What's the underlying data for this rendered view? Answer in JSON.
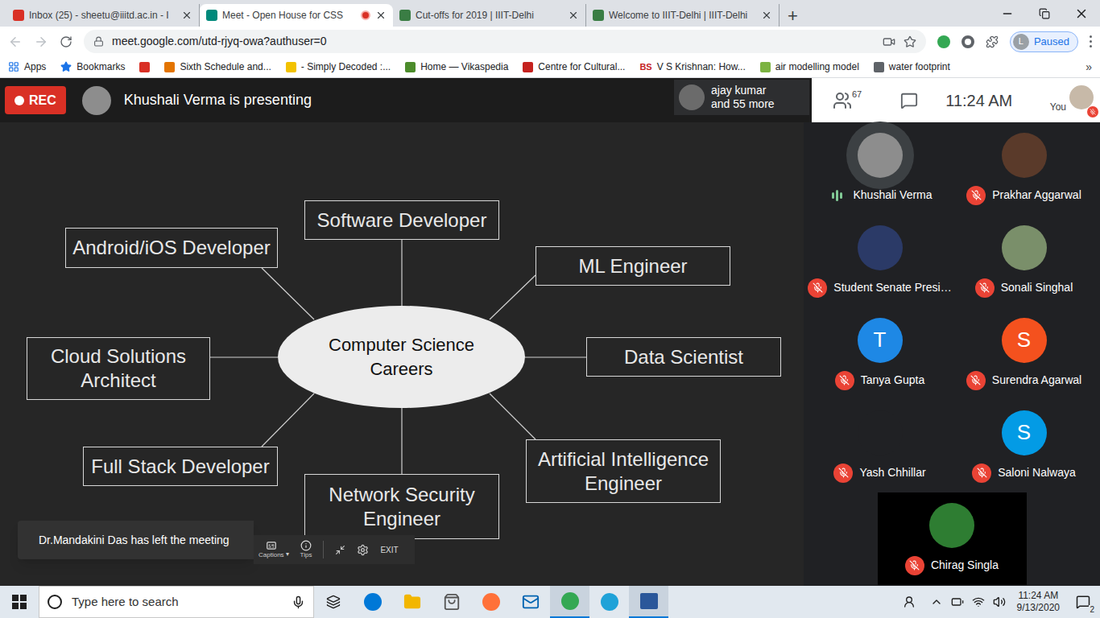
{
  "browser": {
    "tabs": [
      {
        "title": "Inbox (25) - sheetu@iiitd.ac.in - I",
        "selected": false,
        "recording": false,
        "color": "#d93025"
      },
      {
        "title": "Meet - Open House for CSS",
        "selected": true,
        "recording": true,
        "color": "#00897b"
      },
      {
        "title": "Cut-offs for 2019 | IIIT-Delhi",
        "selected": false,
        "recording": false,
        "color": "#3a7d44"
      },
      {
        "title": "Welcome to IIIT-Delhi | IIIT-Delhi",
        "selected": false,
        "recording": false,
        "color": "#3a7d44"
      }
    ],
    "new_tab": "+",
    "url": "meet.google.com/utd-rjyq-owa?authuser=0",
    "profile": {
      "initial": "L",
      "status": "Paused"
    },
    "bookmarks": [
      {
        "label": "Apps",
        "color": "#1a73e8",
        "icon_text": ""
      },
      {
        "label": "Bookmarks",
        "color": "#1a73e8",
        "icon_text": ""
      },
      {
        "label": "",
        "color": "#d93025",
        "icon_text": ""
      },
      {
        "label": "Sixth Schedule and...",
        "color": "#e37400",
        "icon_text": ""
      },
      {
        "label": "- Simply Decoded :...",
        "color": "#f2c200",
        "icon_text": ""
      },
      {
        "label": "Home — Vikaspedia",
        "color": "#4c8c2b",
        "icon_text": ""
      },
      {
        "label": "Centre for Cultural...",
        "color": "#c5221f",
        "icon_text": ""
      },
      {
        "label": "V S Krishnan: How...",
        "color": "#c5221f",
        "icon_text": "BS"
      },
      {
        "label": "air modelling model",
        "color": "#7cb342",
        "icon_text": ""
      },
      {
        "label": "water footprint",
        "color": "#5f6368",
        "icon_text": ""
      }
    ],
    "more_bookmarks": "»"
  },
  "meeting": {
    "rec": "REC",
    "presenter": "Khushali Verma is presenting",
    "others": {
      "name": "ajay kumar",
      "more": "and 55 more"
    },
    "people_count": "67",
    "time": "11:24 AM",
    "self_label": "You",
    "self_muted": true
  },
  "slide": {
    "center": "Computer Science Careers",
    "careers": [
      "Software Developer",
      "ML Engineer",
      "Data Scientist",
      "Artificial Intelligence Engineer",
      "Network Security Engineer",
      "Full Stack Developer",
      "Cloud Solutions Architect",
      "Android/iOS Developer"
    ]
  },
  "participants": [
    {
      "name": "Khushali Verma",
      "muted": false,
      "speaking": true,
      "kind": "photo",
      "letter": "",
      "color": "#8d8d8d"
    },
    {
      "name": "Prakhar Aggarwal",
      "muted": true,
      "speaking": false,
      "kind": "photo",
      "letter": "",
      "color": "#5a3a2a"
    },
    {
      "name": "Student Senate Presi…",
      "muted": true,
      "speaking": false,
      "kind": "photo",
      "letter": "",
      "color": "#2b3a67"
    },
    {
      "name": "Sonali Singhal",
      "muted": true,
      "speaking": false,
      "kind": "photo",
      "letter": "",
      "color": "#7a8f6a"
    },
    {
      "name": "Tanya Gupta",
      "muted": true,
      "speaking": false,
      "kind": "letter",
      "letter": "T",
      "color": "#1e88e5"
    },
    {
      "name": "Surendra Agarwal",
      "muted": true,
      "speaking": false,
      "kind": "letter",
      "letter": "S",
      "color": "#f4511e"
    },
    {
      "name": "Yash Chhillar",
      "muted": true,
      "speaking": false,
      "kind": "photo",
      "letter": "",
      "color": "#202124"
    },
    {
      "name": "Saloni Nalwaya",
      "muted": true,
      "speaking": false,
      "kind": "letter",
      "letter": "S",
      "color": "#039be5"
    },
    {
      "name": "Chirag Singla",
      "muted": true,
      "speaking": false,
      "kind": "photo",
      "letter": "",
      "color": "#2e7d32"
    }
  ],
  "toast": "Dr.Mandakini Das has left the meeting",
  "presenter_toolbar": {
    "captions": "Captions",
    "tips": "Tips",
    "exit": "EXIT"
  },
  "taskbar": {
    "search_placeholder": "Type here to search",
    "time": "11:24 AM",
    "date": "9/13/2020",
    "notifications": "2",
    "apps": [
      {
        "color": "#0078d7",
        "active": false
      },
      {
        "color": "#f2b600",
        "active": false
      },
      {
        "color": "#555555",
        "active": false
      },
      {
        "color": "#ff7139",
        "active": false
      },
      {
        "color": "#0063b1",
        "active": false
      },
      {
        "color": "#34a853",
        "active": true
      },
      {
        "color": "#1fa2d8",
        "active": false
      },
      {
        "color": "#2b579a",
        "active": true
      }
    ]
  }
}
